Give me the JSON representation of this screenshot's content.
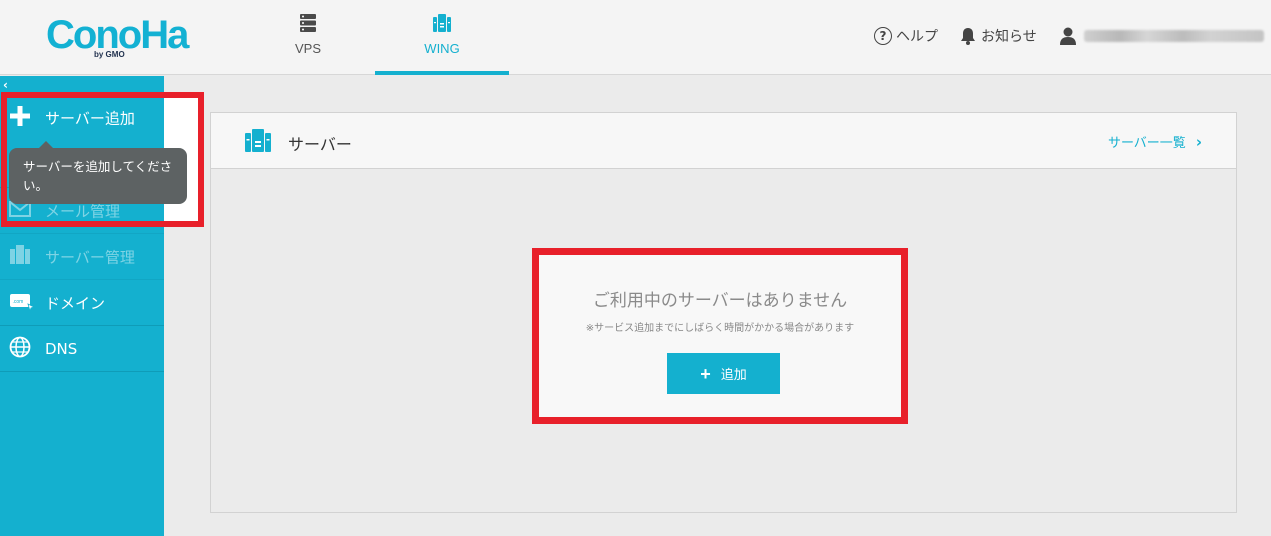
{
  "logo": {
    "text": "ConoHa",
    "by": "by GMO"
  },
  "nav": {
    "tabs": [
      {
        "label": "VPS",
        "icon": "server-stack-icon"
      },
      {
        "label": "WING",
        "icon": "wing-server-icon",
        "active": true
      }
    ]
  },
  "header": {
    "help_label": "ヘルプ",
    "news_label": "お知らせ"
  },
  "sidebar": {
    "collapse_symbol": "‹",
    "items": [
      {
        "label": "サーバー追加",
        "icon": "plus-icon"
      },
      {
        "label": "メール管理",
        "icon": "mail-icon",
        "disabled": true
      },
      {
        "label": "サーバー管理",
        "icon": "server-icon",
        "disabled": true
      },
      {
        "label": "ドメイン",
        "icon": "domain-icon"
      },
      {
        "label": "DNS",
        "icon": "globe-icon"
      }
    ],
    "tooltip": "サーバーを追加してください。"
  },
  "panel": {
    "title": "サーバー",
    "link_label": "サーバー一覧",
    "empty_title": "ご利用中のサーバーはありません",
    "empty_note": "※サービス追加までにしばらく時間がかかる場合があります",
    "add_button_label": "追加"
  },
  "colors": {
    "accent": "#14b0cf",
    "highlight_border": "#e8202a",
    "tooltip_bg": "#5d6263"
  }
}
